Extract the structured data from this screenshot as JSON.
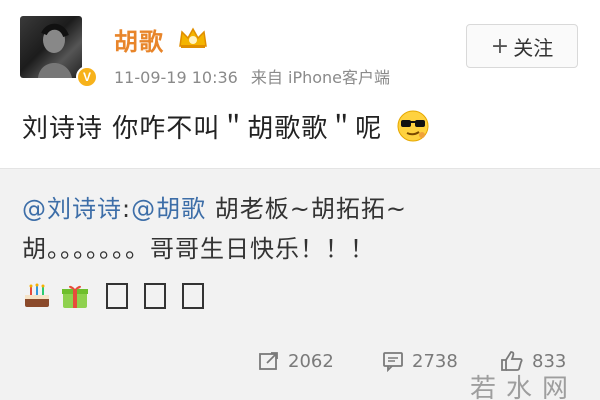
{
  "post": {
    "username": "胡歌",
    "timestamp": "11-09-19 10:36",
    "source": "来自 iPhone客户端",
    "follow_label": "关注",
    "follow_plus": "+",
    "text": "刘诗诗 你咋不叫＂胡歌歌＂呢",
    "verified_badge": "V",
    "icons": {
      "vip": "crown-vip-icon",
      "emoji": "cool-sunglasses-emoji-icon"
    }
  },
  "repost": {
    "mention_user": "@刘诗诗",
    "colon": ":",
    "mention_author": "@胡歌",
    "line1_rest": " 胡老板~胡拓拓~",
    "line2": "胡。。。。。。。哥哥生日快乐！！！",
    "emojis": [
      "cake-emoji-icon",
      "gift-emoji-icon"
    ],
    "missing_glyph_count": 3
  },
  "actions": {
    "repost_count": "2062",
    "comment_count": "2738",
    "like_count": "833"
  },
  "watermark": "若水网",
  "colors": {
    "username": "#e8852a",
    "mention": "#3d6ea8",
    "repost_bg": "#f2f2f2"
  }
}
